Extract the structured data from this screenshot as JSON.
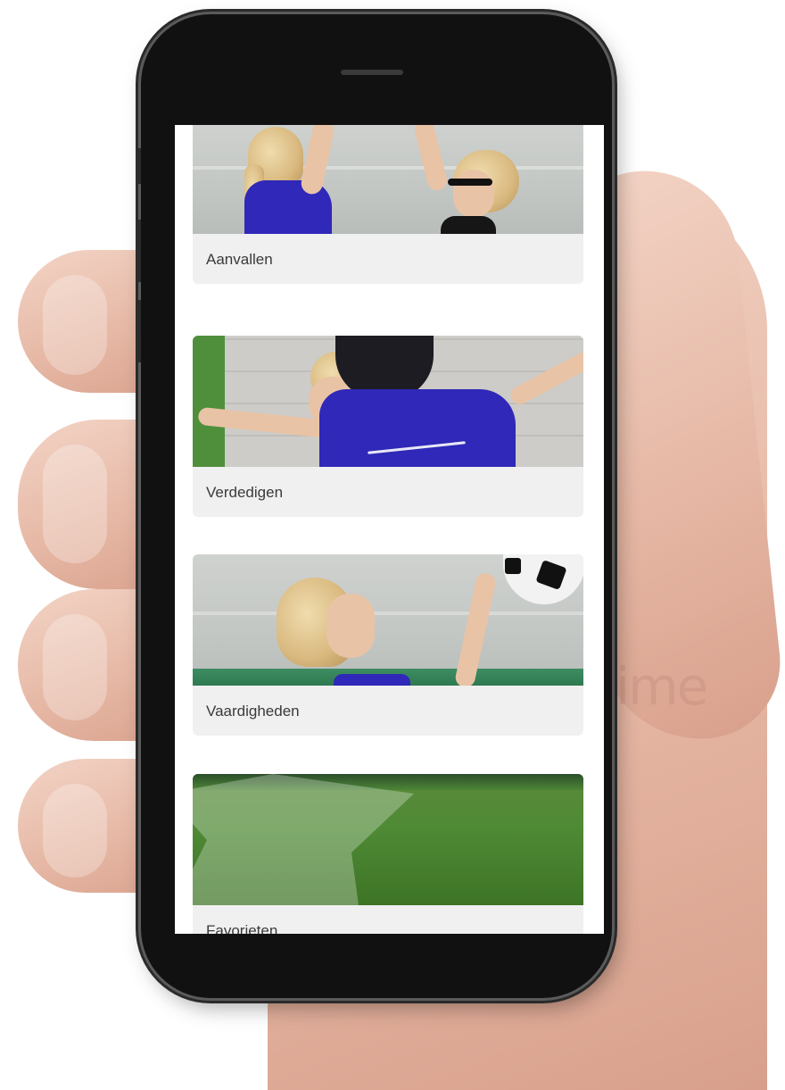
{
  "categories": [
    {
      "label": "Aanvallen",
      "image": "two children in blue jerseys reaching up in a sports hall"
    },
    {
      "label": "Verdedigen",
      "image": "child in blue jersey with arms spread defending"
    },
    {
      "label": "Vaardigheden",
      "image": "girl reaching for a football"
    },
    {
      "label": "Favorieten",
      "image": "grass pitch with star shape"
    }
  ],
  "watermark": "ime",
  "colors": {
    "jersey_blue": "#2f28b8",
    "card_bg": "#f0f0f0",
    "label_text": "#3a3a3a"
  }
}
